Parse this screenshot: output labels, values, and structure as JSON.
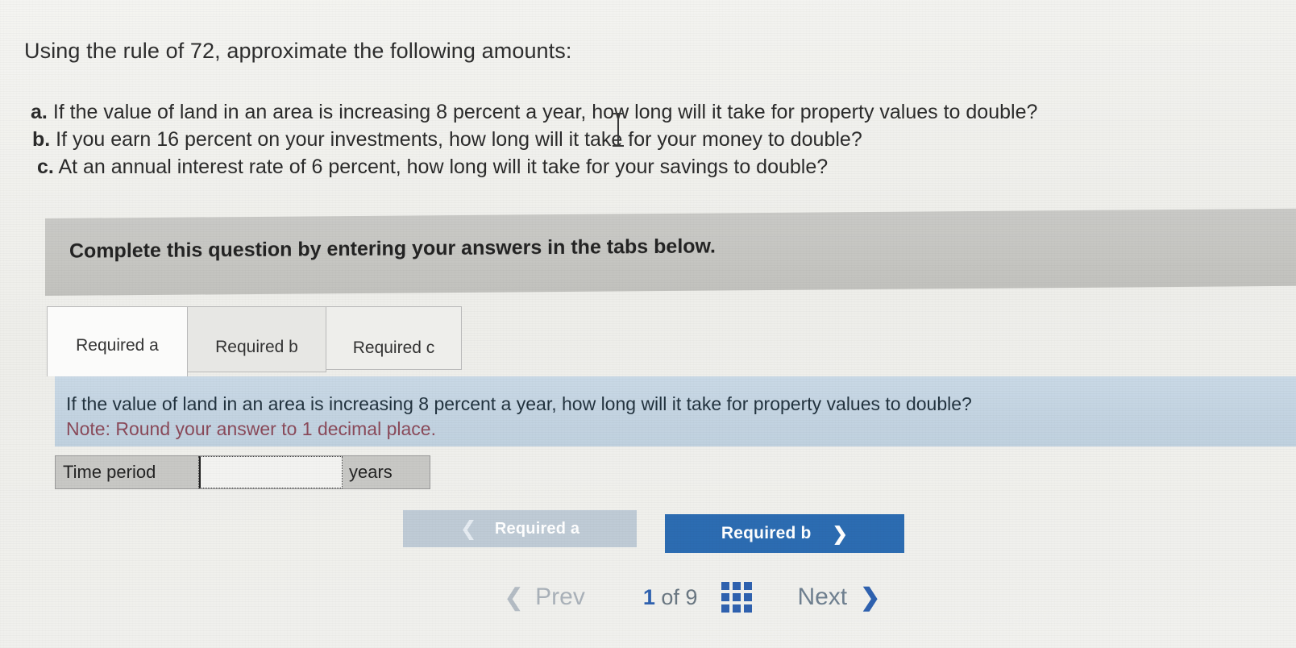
{
  "prompt": {
    "title": "Using the rule of 72, approximate the following amounts:",
    "items": [
      {
        "label": "a.",
        "text": "If the value of land in an area is increasing 8 percent a year, how long will it take for property values to double?"
      },
      {
        "label": "b.",
        "text": "If you earn 16 percent on your investments, how long will it take for your money to double?"
      },
      {
        "label": "c.",
        "text": "At an annual interest rate of 6 percent, how long will it take for your savings to double?"
      }
    ]
  },
  "banner": {
    "text": "Complete this question by entering your answers in the tabs below."
  },
  "tabs": [
    {
      "label": "Required a",
      "active": true
    },
    {
      "label": "Required b",
      "active": false
    },
    {
      "label": "Required c",
      "active": false
    }
  ],
  "question_panel": {
    "question": "If the value of land in an area is increasing 8 percent a year, how long will it take for property values to double?",
    "note": "Note: Round your answer to 1 decimal place.",
    "note_color": "#8a4a5a",
    "background_color": "#c3d3e1"
  },
  "answer_row": {
    "row_label": "Time period",
    "input_value": "",
    "input_placeholder": "",
    "unit_label": "years"
  },
  "requirement_nav": {
    "prev_label": "Required a",
    "prev_icon": "chevron-left-icon",
    "prev_color": "#bfcbd6",
    "next_label": "Required b",
    "next_icon": "chevron-right-icon",
    "next_color": "#2c6cb2"
  },
  "pager": {
    "prev_label": "Prev",
    "prev_icon": "chevron-left-icon",
    "current_page": "1",
    "of_label": "of",
    "total_pages": "9",
    "grid_icon": "grid-3x3-icon",
    "next_label": "Next",
    "next_icon": "chevron-right-icon",
    "accent_color": "#2f62b0"
  },
  "cursor": {
    "type": "text-cursor-ibeam"
  }
}
